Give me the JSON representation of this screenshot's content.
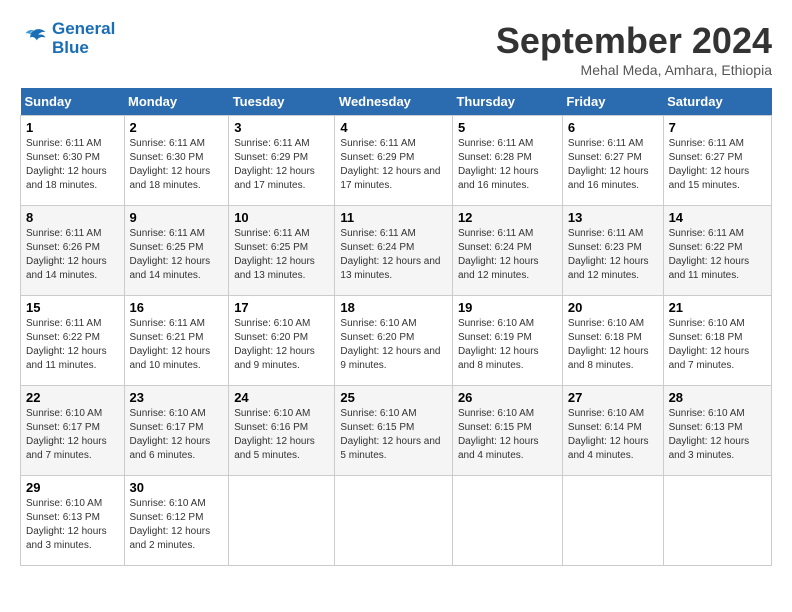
{
  "logo": {
    "line1": "General",
    "line2": "Blue"
  },
  "title": "September 2024",
  "subtitle": "Mehal Meda, Amhara, Ethiopia",
  "weekdays": [
    "Sunday",
    "Monday",
    "Tuesday",
    "Wednesday",
    "Thursday",
    "Friday",
    "Saturday"
  ],
  "weeks": [
    [
      {
        "day": "1",
        "sunrise": "6:11 AM",
        "sunset": "6:30 PM",
        "daylight": "12 hours and 18 minutes."
      },
      {
        "day": "2",
        "sunrise": "6:11 AM",
        "sunset": "6:30 PM",
        "daylight": "12 hours and 18 minutes."
      },
      {
        "day": "3",
        "sunrise": "6:11 AM",
        "sunset": "6:29 PM",
        "daylight": "12 hours and 17 minutes."
      },
      {
        "day": "4",
        "sunrise": "6:11 AM",
        "sunset": "6:29 PM",
        "daylight": "12 hours and 17 minutes."
      },
      {
        "day": "5",
        "sunrise": "6:11 AM",
        "sunset": "6:28 PM",
        "daylight": "12 hours and 16 minutes."
      },
      {
        "day": "6",
        "sunrise": "6:11 AM",
        "sunset": "6:27 PM",
        "daylight": "12 hours and 16 minutes."
      },
      {
        "day": "7",
        "sunrise": "6:11 AM",
        "sunset": "6:27 PM",
        "daylight": "12 hours and 15 minutes."
      }
    ],
    [
      {
        "day": "8",
        "sunrise": "6:11 AM",
        "sunset": "6:26 PM",
        "daylight": "12 hours and 14 minutes."
      },
      {
        "day": "9",
        "sunrise": "6:11 AM",
        "sunset": "6:25 PM",
        "daylight": "12 hours and 14 minutes."
      },
      {
        "day": "10",
        "sunrise": "6:11 AM",
        "sunset": "6:25 PM",
        "daylight": "12 hours and 13 minutes."
      },
      {
        "day": "11",
        "sunrise": "6:11 AM",
        "sunset": "6:24 PM",
        "daylight": "12 hours and 13 minutes."
      },
      {
        "day": "12",
        "sunrise": "6:11 AM",
        "sunset": "6:24 PM",
        "daylight": "12 hours and 12 minutes."
      },
      {
        "day": "13",
        "sunrise": "6:11 AM",
        "sunset": "6:23 PM",
        "daylight": "12 hours and 12 minutes."
      },
      {
        "day": "14",
        "sunrise": "6:11 AM",
        "sunset": "6:22 PM",
        "daylight": "12 hours and 11 minutes."
      }
    ],
    [
      {
        "day": "15",
        "sunrise": "6:11 AM",
        "sunset": "6:22 PM",
        "daylight": "12 hours and 11 minutes."
      },
      {
        "day": "16",
        "sunrise": "6:11 AM",
        "sunset": "6:21 PM",
        "daylight": "12 hours and 10 minutes."
      },
      {
        "day": "17",
        "sunrise": "6:10 AM",
        "sunset": "6:20 PM",
        "daylight": "12 hours and 9 minutes."
      },
      {
        "day": "18",
        "sunrise": "6:10 AM",
        "sunset": "6:20 PM",
        "daylight": "12 hours and 9 minutes."
      },
      {
        "day": "19",
        "sunrise": "6:10 AM",
        "sunset": "6:19 PM",
        "daylight": "12 hours and 8 minutes."
      },
      {
        "day": "20",
        "sunrise": "6:10 AM",
        "sunset": "6:18 PM",
        "daylight": "12 hours and 8 minutes."
      },
      {
        "day": "21",
        "sunrise": "6:10 AM",
        "sunset": "6:18 PM",
        "daylight": "12 hours and 7 minutes."
      }
    ],
    [
      {
        "day": "22",
        "sunrise": "6:10 AM",
        "sunset": "6:17 PM",
        "daylight": "12 hours and 7 minutes."
      },
      {
        "day": "23",
        "sunrise": "6:10 AM",
        "sunset": "6:17 PM",
        "daylight": "12 hours and 6 minutes."
      },
      {
        "day": "24",
        "sunrise": "6:10 AM",
        "sunset": "6:16 PM",
        "daylight": "12 hours and 5 minutes."
      },
      {
        "day": "25",
        "sunrise": "6:10 AM",
        "sunset": "6:15 PM",
        "daylight": "12 hours and 5 minutes."
      },
      {
        "day": "26",
        "sunrise": "6:10 AM",
        "sunset": "6:15 PM",
        "daylight": "12 hours and 4 minutes."
      },
      {
        "day": "27",
        "sunrise": "6:10 AM",
        "sunset": "6:14 PM",
        "daylight": "12 hours and 4 minutes."
      },
      {
        "day": "28",
        "sunrise": "6:10 AM",
        "sunset": "6:13 PM",
        "daylight": "12 hours and 3 minutes."
      }
    ],
    [
      {
        "day": "29",
        "sunrise": "6:10 AM",
        "sunset": "6:13 PM",
        "daylight": "12 hours and 3 minutes."
      },
      {
        "day": "30",
        "sunrise": "6:10 AM",
        "sunset": "6:12 PM",
        "daylight": "12 hours and 2 minutes."
      },
      null,
      null,
      null,
      null,
      null
    ]
  ],
  "labels": {
    "sunrise": "Sunrise:",
    "sunset": "Sunset:",
    "daylight": "Daylight:"
  }
}
